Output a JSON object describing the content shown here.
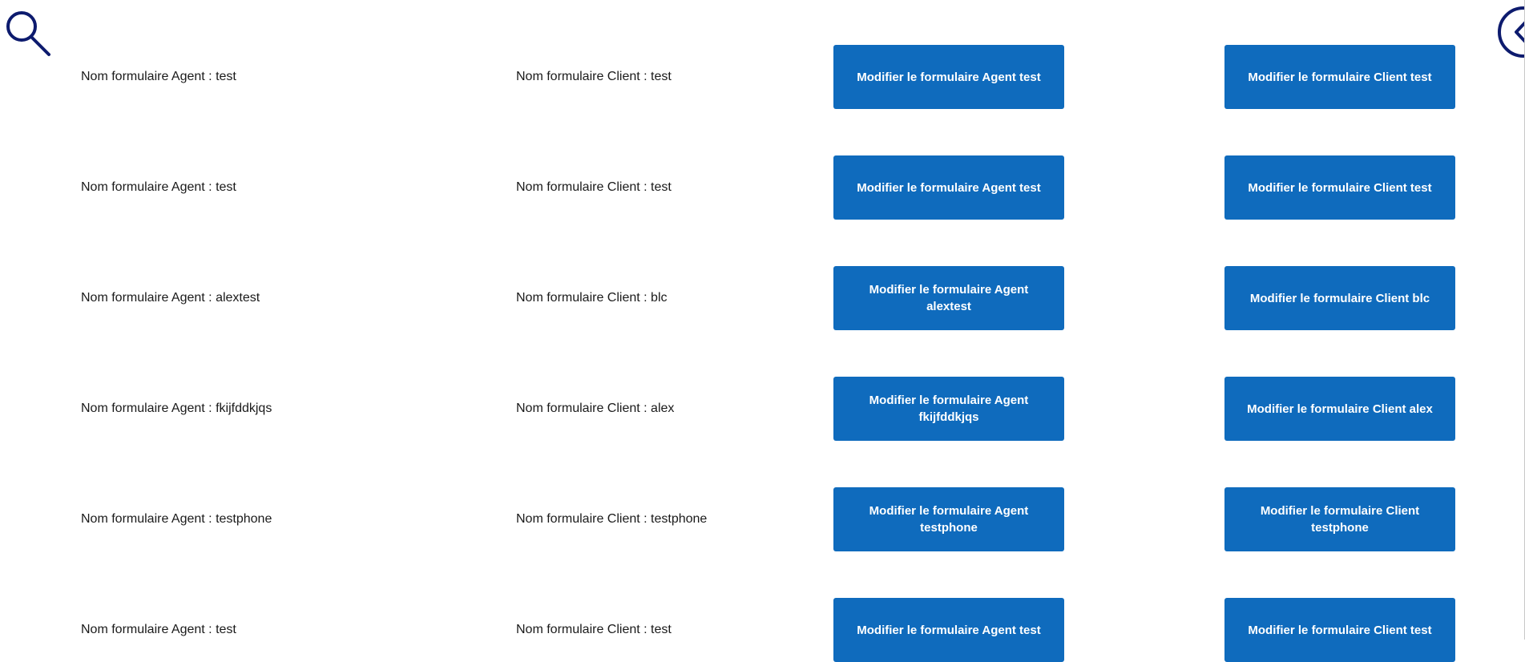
{
  "toolbar": {
    "search_icon": "search-icon",
    "back_icon": "chevron-left-circle-icon",
    "icon_color": "#0d1b6e"
  },
  "colors": {
    "button_background": "#0f6bbd",
    "button_text": "#ffffff",
    "label_text": "#1a1a1a"
  },
  "rows": [
    {
      "agent_label": "Nom formulaire Agent : test",
      "client_label": "Nom formulaire Client : test",
      "agent_button": "Modifier le formulaire Agent test",
      "client_button": "Modifier le formulaire Client test"
    },
    {
      "agent_label": "Nom formulaire Agent : test",
      "client_label": "Nom formulaire Client : test",
      "agent_button": "Modifier le formulaire Agent test",
      "client_button": "Modifier le formulaire Client test"
    },
    {
      "agent_label": "Nom formulaire Agent : alextest",
      "client_label": "Nom formulaire Client : blc",
      "agent_button": "Modifier le formulaire Agent alextest",
      "client_button": "Modifier le formulaire Client blc"
    },
    {
      "agent_label": "Nom formulaire Agent : fkijfddkjqs",
      "client_label": "Nom formulaire Client : alex",
      "agent_button": "Modifier le formulaire Agent fkijfddkjqs",
      "client_button": "Modifier le formulaire Client alex"
    },
    {
      "agent_label": "Nom formulaire Agent : testphone",
      "client_label": "Nom formulaire Client : testphone",
      "agent_button": "Modifier le formulaire Agent testphone",
      "client_button": "Modifier le formulaire Client testphone"
    },
    {
      "agent_label": "Nom formulaire Agent : test",
      "client_label": "Nom formulaire Client : test",
      "agent_button": "Modifier le formulaire Agent test",
      "client_button": "Modifier le formulaire Client test"
    }
  ]
}
